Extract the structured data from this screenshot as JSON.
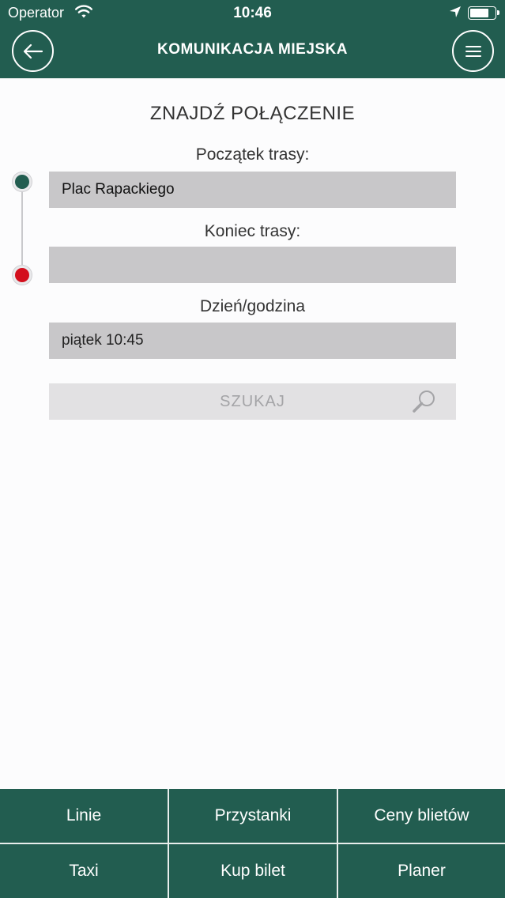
{
  "status_bar": {
    "carrier": "Operator",
    "time": "10:46",
    "wifi_icon": "wifi-icon",
    "location_icon": "location-arrow-icon",
    "battery_icon": "battery-icon"
  },
  "nav": {
    "title": "KOMUNIKACJA MIEJSKA",
    "back_icon": "back-arrow-icon",
    "menu_icon": "hamburger-menu-icon"
  },
  "form": {
    "title": "ZNAJDŹ POŁĄCZENIE",
    "start_label": "Początek trasy:",
    "start_value": "Plac Rapackiego",
    "end_label": "Koniec trasy:",
    "end_value": "",
    "datetime_label": "Dzień/godzina",
    "datetime_value": "piątek 10:45",
    "search_label": "SZUKAJ"
  },
  "bottom_menu": {
    "row1": [
      "Linie",
      "Przystanki",
      "Ceny blietów"
    ],
    "row2": [
      "Taxi",
      "Kup bilet",
      "Planer"
    ]
  },
  "colors": {
    "primary": "#225d50",
    "start_dot": "#225d50",
    "end_dot": "#d30f1d",
    "field_bg": "#c8c7c9",
    "button_bg": "#e2e1e3"
  }
}
